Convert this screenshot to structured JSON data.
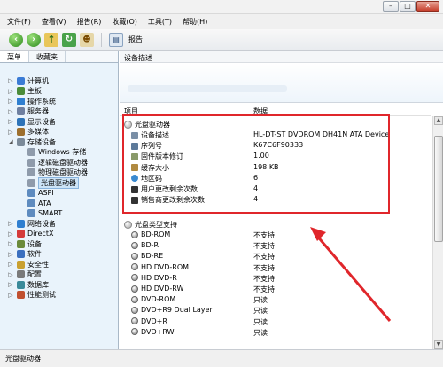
{
  "menu": [
    "文件(F)",
    "查看(V)",
    "报告(R)",
    "收藏(O)",
    "工具(T)",
    "帮助(H)"
  ],
  "toolbar": {
    "report_label": "报告"
  },
  "left_tabs": [
    "菜单",
    "收藏夹"
  ],
  "tree": [
    {
      "label": "计算机",
      "color": "#3a7bd5",
      "arrow": "▷"
    },
    {
      "label": "主板",
      "color": "#4a8c3a",
      "arrow": "▷"
    },
    {
      "label": "操作系统",
      "color": "#2f7fd0",
      "arrow": "▷"
    },
    {
      "label": "服务器",
      "color": "#6e7fa0",
      "arrow": "▷"
    },
    {
      "label": "显示设备",
      "color": "#2d73b8",
      "arrow": "▷"
    },
    {
      "label": "多媒体",
      "color": "#9d6f2e",
      "arrow": "▷"
    },
    {
      "label": "存储设备",
      "color": "#7b8a99",
      "arrow": "◢"
    },
    {
      "label": "Windows 存储",
      "color": "#8f9bab",
      "arrow": ""
    },
    {
      "label": "逻辑磁盘驱动器",
      "color": "#8f9bab",
      "arrow": ""
    },
    {
      "label": "物理磁盘驱动器",
      "color": "#8f9bab",
      "arrow": ""
    },
    {
      "label": "光盘驱动器",
      "color": "#8f9bab",
      "arrow": ""
    },
    {
      "label": "ASPI",
      "color": "#5e8bbf",
      "arrow": ""
    },
    {
      "label": "ATA",
      "color": "#5e8bbf",
      "arrow": ""
    },
    {
      "label": "SMART",
      "color": "#5e8bbf",
      "arrow": ""
    },
    {
      "label": "网络设备",
      "color": "#2f7fd0",
      "arrow": "▷"
    },
    {
      "label": "DirectX",
      "color": "#d43a3a",
      "arrow": "▷"
    },
    {
      "label": "设备",
      "color": "#6a8a3a",
      "arrow": "▷"
    },
    {
      "label": "软件",
      "color": "#3a6fbf",
      "arrow": "▷"
    },
    {
      "label": "安全性",
      "color": "#c9a030",
      "arrow": "▷"
    },
    {
      "label": "配置",
      "color": "#7a7a7a",
      "arrow": "▷"
    },
    {
      "label": "数据库",
      "color": "#3a8a9a",
      "arrow": "▷"
    },
    {
      "label": "性能测试",
      "color": "#c05030",
      "arrow": "▷"
    }
  ],
  "right": {
    "desc_title": "设备描述",
    "col_item": "项目",
    "col_data": "数据"
  },
  "section1": {
    "title": "光盘驱动器",
    "rows": [
      {
        "name": "设备描述",
        "value": "HL-DT-ST DVDROM DH41N ATA Device"
      },
      {
        "name": "序列号",
        "value": "K67C6F90333"
      },
      {
        "name": "固件版本修订",
        "value": "1.00"
      },
      {
        "name": "缓存大小",
        "value": "198 KB"
      },
      {
        "name": "地区码",
        "value": "6"
      },
      {
        "name": "用户更改剩余次数",
        "value": "4"
      },
      {
        "name": "销售商更改剩余次数",
        "value": "4"
      }
    ]
  },
  "section2": {
    "title": "光盘类型支持",
    "rows": [
      {
        "name": "BD-ROM",
        "value": "不支持"
      },
      {
        "name": "BD-R",
        "value": "不支持"
      },
      {
        "name": "BD-RE",
        "value": "不支持"
      },
      {
        "name": "HD DVD-ROM",
        "value": "不支持"
      },
      {
        "name": "HD DVD-R",
        "value": "不支持"
      },
      {
        "name": "HD DVD-RW",
        "value": "不支持"
      },
      {
        "name": "DVD-ROM",
        "value": "只读"
      },
      {
        "name": "DVD+R9 Dual Layer",
        "value": "只读"
      },
      {
        "name": "DVD+R",
        "value": "只读"
      },
      {
        "name": "DVD+RW",
        "value": "只读"
      }
    ]
  },
  "status": "光盘驱动器",
  "colors": {
    "highlight": "#e0262b",
    "selection": "#cde4f7"
  }
}
